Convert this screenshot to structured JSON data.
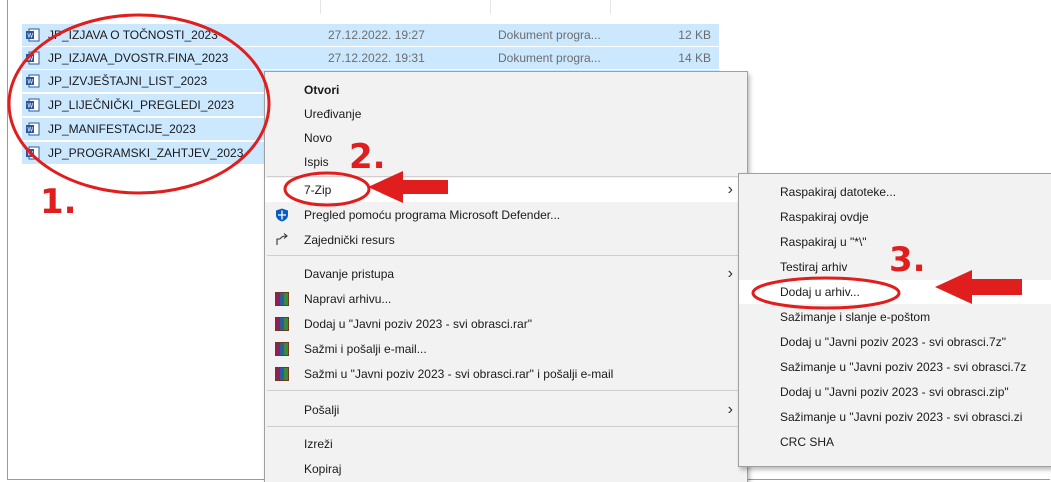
{
  "files": [
    {
      "name": "JP_IZJAVA O TOČNOSTI_2023",
      "date": "27.12.2022. 19:27",
      "type": "Dokument progra...",
      "size": "12 KB"
    },
    {
      "name": "JP_IZJAVA_DVOSTR.FINA_2023",
      "date": "27.12.2022. 19:31",
      "type": "Dokument progra...",
      "size": "14 KB"
    },
    {
      "name": "JP_IZVJEŠTAJNI_LIST_2023",
      "date": "",
      "type": "",
      "size": ""
    },
    {
      "name": "JP_LIJEČNIČKI_PREGLEDI_2023",
      "date": "",
      "type": "",
      "size": ""
    },
    {
      "name": "JP_MANIFESTACIJE_2023",
      "date": "",
      "type": "",
      "size": ""
    },
    {
      "name": "JP_PROGRAMSKI_ZAHTJEV_2023",
      "date": "",
      "type": "",
      "size": ""
    }
  ],
  "context_menu": {
    "open": "Otvori",
    "edit": "Uređivanje",
    "new": "Novo",
    "print": "Ispis",
    "sevenzip": "7-Zip",
    "defender": "Pregled pomoću programa Microsoft Defender...",
    "share": "Zajednički resurs",
    "give_access": "Davanje pristupa",
    "make_archive": "Napravi arhivu...",
    "add_rar": "Dodaj u \"Javni poziv 2023 - svi obrasci.rar\"",
    "compress_email": "Sažmi i pošalji e-mail...",
    "compress_rar_email": "Sažmi u \"Javni poziv 2023 - svi obrasci.rar\" i pošalji e-mail",
    "send_to": "Pošalji",
    "cut": "Izreži",
    "copy": "Kopiraj"
  },
  "submenu": {
    "items": [
      "Raspakiraj datoteke...",
      "Raspakiraj ovdje",
      "Raspakiraj u \"*\\\"",
      "Testiraj arhiv",
      "Dodaj u arhiv...",
      "Sažimanje i slanje e-poštom",
      "Dodaj u \"Javni poziv 2023 - svi obrasci.7z\"",
      "Sažimanje u \"Javni poziv 2023 - svi obrasci.7z",
      "Dodaj u \"Javni poziv 2023 - svi obrasci.zip\"",
      "Sažimanje u \"Javni poziv 2023 - svi obrasci.zi",
      "CRC SHA"
    ]
  },
  "annotations": {
    "step1": "1.",
    "step2": "2.",
    "step3": "3.",
    "color": "#e01e1e"
  },
  "icons": {
    "file": "word-doc-icon",
    "defender": "defender-shield-icon",
    "share": "share-icon",
    "archive": "winrar-icon",
    "chevron": "chevron-right-icon"
  }
}
